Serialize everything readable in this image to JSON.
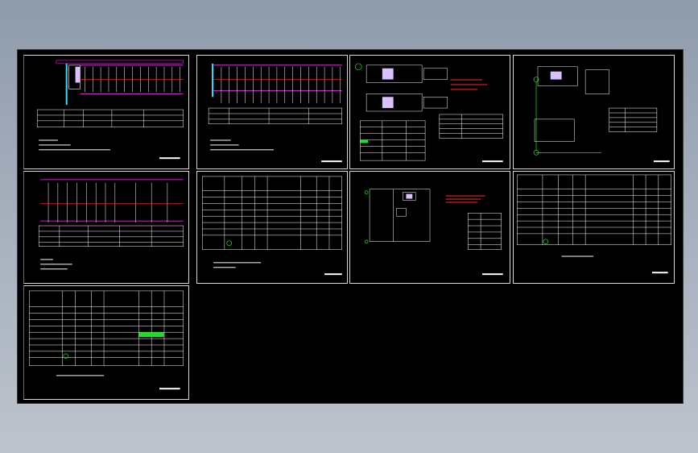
{
  "app": {
    "title": ""
  },
  "colors": {
    "background_top": "#8f9bab",
    "canvas": "#000000",
    "sheet_border": "#d8d8d8",
    "line_white": "#ffffff",
    "line_red": "#ff2b2b",
    "line_magenta": "#ff33ff",
    "line_cyan": "#33e0ff",
    "line_green": "#33ff33",
    "highlight_green": "#22dd22"
  },
  "sheets": [
    {
      "id": "sheet-1",
      "kind": "panel-schematic",
      "label": ""
    },
    {
      "id": "sheet-2",
      "kind": "panel-schematic",
      "label": ""
    },
    {
      "id": "sheet-3",
      "kind": "cabinet-layout",
      "label": ""
    },
    {
      "id": "sheet-4",
      "kind": "plan-layout",
      "label": ""
    },
    {
      "id": "sheet-5",
      "kind": "panel-schematic",
      "label": ""
    },
    {
      "id": "sheet-6",
      "kind": "table",
      "label": ""
    },
    {
      "id": "sheet-7",
      "kind": "control-circuit",
      "label": ""
    },
    {
      "id": "sheet-8",
      "kind": "table",
      "label": ""
    },
    {
      "id": "sheet-9",
      "kind": "table",
      "label": ""
    }
  ]
}
